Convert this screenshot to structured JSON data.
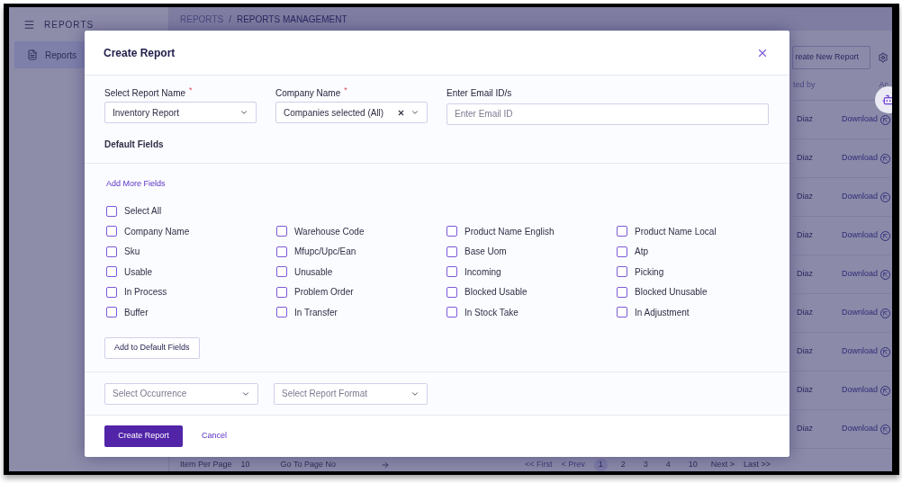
{
  "sidebar": {
    "title": "REPORTS",
    "items": [
      {
        "label": "Reports",
        "selected": true
      }
    ]
  },
  "breadcrumb": {
    "items": [
      "REPORTS",
      "REPORTS MANAGEMENT"
    ],
    "separator": "/"
  },
  "toolbar": {
    "create_button": "reate New Report"
  },
  "table": {
    "headers": [
      "ted by",
      "Ac"
    ],
    "rows": [
      {
        "created_by": "Diaz",
        "action": "Download"
      },
      {
        "created_by": "Diaz",
        "action": "Download"
      },
      {
        "created_by": "Diaz",
        "action": "Download"
      },
      {
        "created_by": "Diaz",
        "action": "Download"
      },
      {
        "created_by": "Diaz",
        "action": "Download"
      },
      {
        "created_by": "Diaz",
        "action": "Download"
      },
      {
        "created_by": "Diaz",
        "action": "Download"
      },
      {
        "created_by": "Diaz",
        "action": "Download"
      },
      {
        "created_by": "Diaz",
        "action": "Download"
      }
    ]
  },
  "pagination": {
    "items_label": "Item Per Page",
    "items_value": "10",
    "goto_label": "Go To Page No",
    "first": "<< First",
    "prev": "< Prev",
    "pages": [
      {
        "label": "1",
        "selected": true
      },
      {
        "label": "2",
        "selected": false
      },
      {
        "label": "3",
        "selected": false
      },
      {
        "label": "4",
        "selected": false
      },
      {
        "label": "10",
        "selected": false
      }
    ],
    "next": "Next >",
    "last": "Last >>"
  },
  "modal": {
    "title": "Create Report",
    "report_name": {
      "label": "Select Report Name",
      "required_mark": "*",
      "value": "Inventory Report"
    },
    "company": {
      "label": "Company Name",
      "required_mark": "*",
      "value": "Companies selected (All)"
    },
    "email": {
      "label": "Enter Email ID/s",
      "placeholder": "Enter Email ID"
    },
    "default_fields_heading": "Default Fields",
    "add_more_link": "Add More Fields",
    "select_all": {
      "label": "Select All",
      "checked": false
    },
    "fields": [
      {
        "label": "Company Name",
        "checked": false
      },
      {
        "label": "Warehouse Code",
        "checked": false
      },
      {
        "label": "Product Name English",
        "checked": false
      },
      {
        "label": "Product Name Local",
        "checked": false
      },
      {
        "label": "Sku",
        "checked": false
      },
      {
        "label": "Mfupc/Upc/Ean",
        "checked": false
      },
      {
        "label": "Base Uom",
        "checked": false
      },
      {
        "label": "Atp",
        "checked": false
      },
      {
        "label": "Usable",
        "checked": false
      },
      {
        "label": "Unusable",
        "checked": false
      },
      {
        "label": "Incoming",
        "checked": false
      },
      {
        "label": "Picking",
        "checked": false
      },
      {
        "label": "In Process",
        "checked": false
      },
      {
        "label": "Problem Order",
        "checked": false
      },
      {
        "label": "Blocked Usable",
        "checked": false
      },
      {
        "label": "Blocked Unusable",
        "checked": false
      },
      {
        "label": "Buffer",
        "checked": false
      },
      {
        "label": "In Transfer",
        "checked": false
      },
      {
        "label": "In Stock Take",
        "checked": false
      },
      {
        "label": "In Adjustment",
        "checked": false
      }
    ],
    "add_default_button": "Add to Default Fields",
    "occurrence": {
      "placeholder": "Select Occurrence"
    },
    "format": {
      "placeholder": "Select Report Format"
    },
    "submit_button": "Create Report",
    "cancel_link": "Cancel"
  }
}
